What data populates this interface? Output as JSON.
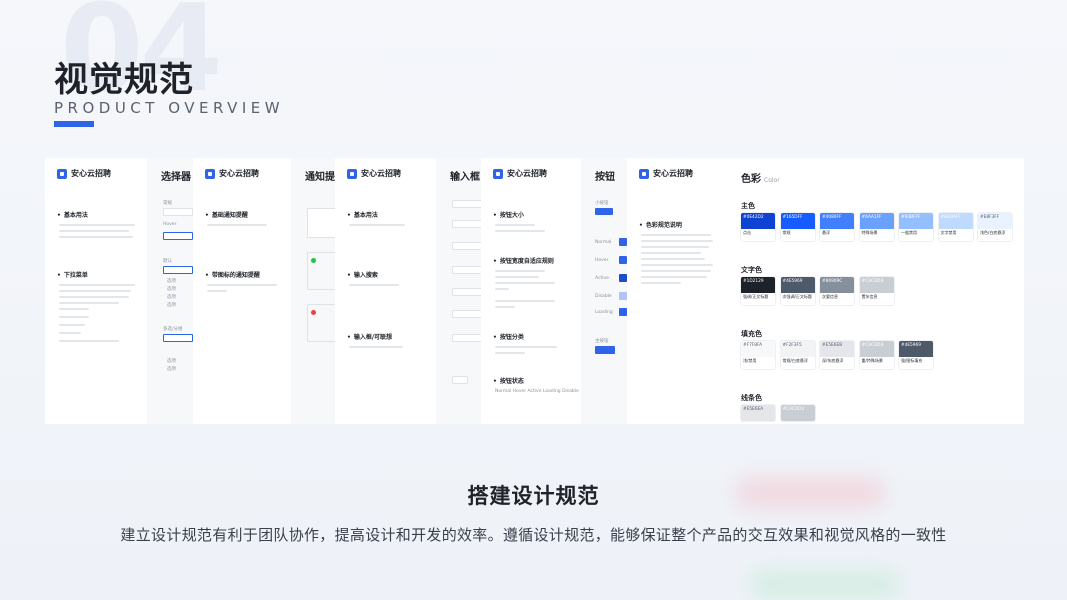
{
  "header": {
    "title": "视觉规范",
    "subtitle": "PRODUCT OVERVIEW"
  },
  "brand": {
    "name": "安心云招聘",
    "accent": "#2f63e8"
  },
  "panels": {
    "p1": {
      "sections": [
        "基本用法",
        "下拉菜单"
      ]
    },
    "p2": {
      "title": "选择器",
      "labels": [
        "常规",
        "Hover",
        "默认",
        "多选/分组"
      ],
      "options": [
        "选项",
        "选项",
        "选项",
        "选项",
        "选项",
        "选项"
      ]
    },
    "p3": {
      "sections": [
        "基础通知提醒",
        "带图标的通知提醒"
      ]
    },
    "p4": {
      "title": "通知提"
    },
    "p5": {
      "sections": [
        "基本用法",
        "输入搜索",
        "输入框/可联想"
      ]
    },
    "p6": {
      "title": "输入框"
    },
    "p7": {
      "sections": [
        "按钮大小",
        "按钮宽度自适应规则",
        "按钮分类",
        "按钮状态"
      ],
      "states": "Normal Hover Active Loading Disable"
    },
    "p8": {
      "title": "按钮",
      "state_labels": [
        "小按钮",
        "Normal",
        "Hover",
        "Active",
        "Disable",
        "Loading",
        "主按钮"
      ]
    },
    "p9": {
      "sections": [
        "色彩规范说明"
      ]
    },
    "p10": {
      "title": "色彩",
      "title_en": "Color",
      "groups": [
        {
          "name": "主色",
          "swatches": [
            {
              "hex": "#0E42D2",
              "label": "点击"
            },
            {
              "hex": "#165DFF",
              "label": "常规"
            },
            {
              "hex": "#4080FF",
              "label": "悬浮"
            },
            {
              "hex": "#6AA1FF",
              "label": "特殊场景"
            },
            {
              "hex": "#94BFFF",
              "label": "一般禁用"
            },
            {
              "hex": "#BEDAFF",
              "label": "文字禁用"
            },
            {
              "hex": "#E8F3FF",
              "label": "浅色/白底悬浮"
            }
          ]
        },
        {
          "name": "文字色",
          "swatches": [
            {
              "hex": "#1D2129",
              "label": "强调/正文标题"
            },
            {
              "hex": "#4E5969",
              "label": "次强调/正文标题"
            },
            {
              "hex": "#86909C",
              "label": "次要信息"
            },
            {
              "hex": "#C9CDD4",
              "label": "置灰信息"
            }
          ]
        },
        {
          "name": "填充色",
          "swatches": [
            {
              "hex": "#F7F8FA",
              "label": "浅/禁用"
            },
            {
              "hex": "#F2F3F5",
              "label": "常规/白底悬浮"
            },
            {
              "hex": "#E5E6EB",
              "label": "深/灰底悬浮"
            },
            {
              "hex": "#C9CDD4",
              "label": "重/特殊场景"
            },
            {
              "hex": "#4E5969",
              "label": "强/图标填充"
            }
          ]
        },
        {
          "name": "线条色",
          "swatches": [
            {
              "hex": "#E5E6EA",
              "label": ""
            },
            {
              "hex": "#C9CDD4",
              "label": ""
            }
          ]
        }
      ]
    }
  },
  "footer": {
    "heading": "搭建设计规范",
    "description": "建立设计规范有利于团队协作，提高设计和开发的效率。遵循设计规范，能够保证整个产品的交互效果和视觉风格的一致性"
  }
}
